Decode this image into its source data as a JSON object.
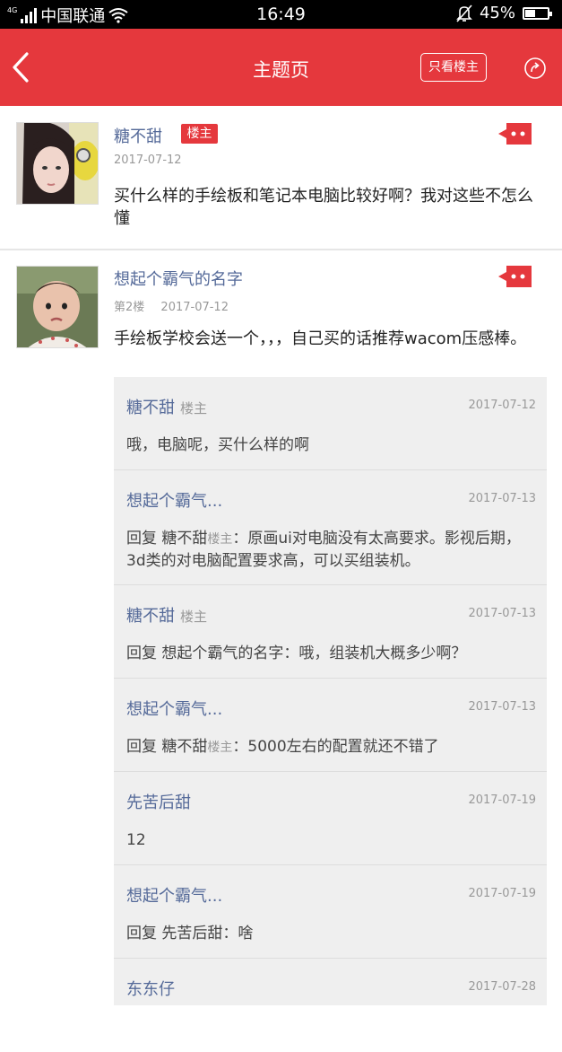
{
  "status_bar": {
    "network": "4G",
    "carrier": "中国联通",
    "time": "16:49",
    "battery": "45%",
    "battery_level": 0.45
  },
  "nav": {
    "title": "主题页",
    "only_owner": "只看楼主"
  },
  "posts": [
    {
      "author": "糖不甜",
      "badge": "楼主",
      "floor": "",
      "date": "2017-07-12",
      "content": "买什么样的手绘板和笔记本电脑比较好啊？我对这些不怎么懂"
    },
    {
      "author": "想起个霸气的名字",
      "floor": "第2楼",
      "date": "2017-07-12",
      "content": "手绘板学校会送一个，，，自己买的话推荐wacom压感棒。"
    }
  ],
  "comments": [
    {
      "name": "糖不甜",
      "owner": "楼主",
      "date": "2017-07-12",
      "prefix": "",
      "ref_name": "",
      "ref_owner": "",
      "text": "哦，电脑呢，买什么样的啊"
    },
    {
      "name": "想起个霸气...",
      "owner": "",
      "date": "2017-07-13",
      "prefix": "回复 ",
      "ref_name": "糖不甜",
      "ref_owner": "楼主",
      "text": "：原画ui对电脑没有太高要求。影视后期，3d类的对电脑配置要求高，可以买组装机。"
    },
    {
      "name": "糖不甜",
      "owner": "楼主",
      "date": "2017-07-13",
      "prefix": "回复 ",
      "ref_name": "想起个霸气的名字",
      "ref_owner": "",
      "text": "：哦，组装机大概多少啊？"
    },
    {
      "name": "想起个霸气...",
      "owner": "",
      "date": "2017-07-13",
      "prefix": "回复 ",
      "ref_name": "糖不甜",
      "ref_owner": "楼主",
      "text": "：5000左右的配置就还不错了"
    },
    {
      "name": "先苦后甜",
      "owner": "",
      "date": "2017-07-19",
      "prefix": "",
      "ref_name": "",
      "ref_owner": "",
      "text": "12"
    },
    {
      "name": "想起个霸气...",
      "owner": "",
      "date": "2017-07-19",
      "prefix": "回复 ",
      "ref_name": "先苦后甜",
      "ref_owner": "",
      "text": "：啥"
    },
    {
      "name": "东东仔",
      "owner": "",
      "date": "2017-07-28",
      "prefix": "",
      "ref_name": "",
      "ref_owner": "",
      "text": ""
    }
  ],
  "colors": {
    "brand_red": "#e5383d",
    "name_blue": "#556a99"
  }
}
